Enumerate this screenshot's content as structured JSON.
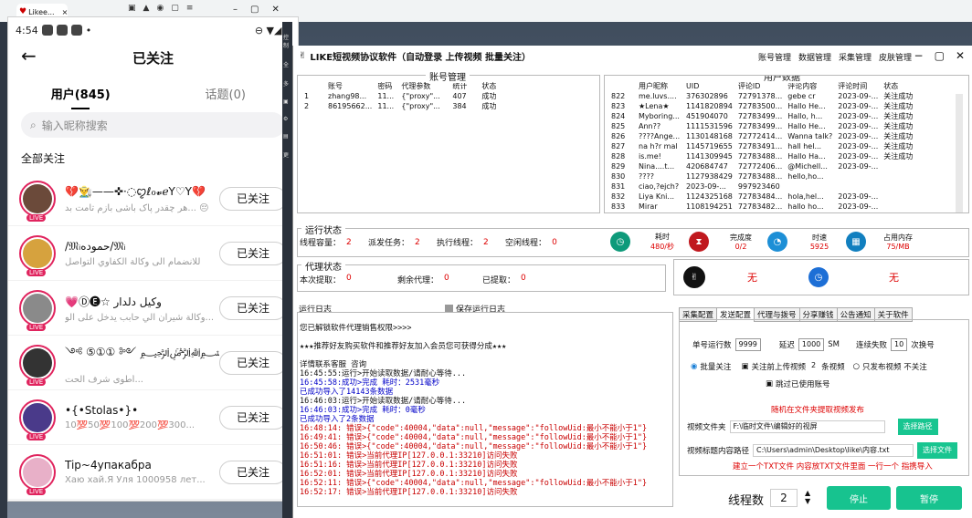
{
  "browser": {
    "tab_label": "Likee..."
  },
  "phone": {
    "time": "4:54",
    "title": "已关注",
    "tabs": [
      {
        "label": "用户(845)"
      },
      {
        "label": "话题(0)"
      }
    ],
    "search_placeholder": "输入昵称搜索",
    "section": "全部关注",
    "follow_label": "已关注",
    "live_label": "LIVE",
    "users": [
      {
        "name": "💔👨‍🌾——✜·◌ꨄℓℴ𝓿ℯY♡Y💔",
        "desc": "هر چقدر پاک باشی بازم تامت بد... 😔",
        "color": "#6b4a3a"
      },
      {
        "name": "/𝔐ᵢحموده/𝔐ᵢ",
        "desc": "للانضمام الى وكالة الكفاوي التواصل",
        "color": "#d6a23e"
      },
      {
        "name": "💗Ⓓ🅔☆ وكيل دلدار",
        "desc": "وكالة شيران الي حابب يدخل على الو...",
        "color": "#8a8a8a"
      },
      {
        "name": "༺ ⑤①① ༻ ﷽ سكدان ...د",
        "desc": "أطوى شرف الحت...",
        "color": "#333333"
      },
      {
        "name": "•{•Stolas•}•",
        "desc": "10💯50💯100💯200💯300...",
        "color": "#4a3a8a"
      },
      {
        "name": "Tip~4упакабра",
        "desc": "Хаю хай.Я Уля 1000958 лет...",
        "color": "#e8b0c8"
      }
    ]
  },
  "app": {
    "title": "LIKE短视频协议软件（自动登录 上传视频 批量关注）",
    "menu": [
      "账号管理",
      "数据管理",
      "采集管理",
      "皮肤管理"
    ],
    "accounts": {
      "caption": "账号管理",
      "headers": [
        "",
        "账号",
        "密码",
        "代理参数",
        "统计",
        "状态"
      ],
      "rows": [
        [
          "1",
          "zhang98...",
          "11...",
          "{\"proxy\"...",
          "407",
          "成功"
        ],
        [
          "2",
          "86195662...",
          "11...",
          "{\"proxy\"...",
          "384",
          "成功"
        ]
      ]
    },
    "users": {
      "caption": "用户数据",
      "headers": [
        "",
        "用户昵称",
        "UID",
        "评论ID",
        "评论内容",
        "评论时间",
        "状态"
      ],
      "rows": [
        [
          "822",
          "me.luvs....",
          "376302896",
          "72791378...",
          "gebe cr",
          "2023-09-...",
          "关注成功"
        ],
        [
          "823",
          "★Lena★",
          "1141820894",
          "72783500...",
          "Hallo He...",
          "2023-09-...",
          "关注成功"
        ],
        [
          "824",
          "Myboring...",
          "451904070",
          "72783499...",
          "Hallo, h...",
          "2023-09-...",
          "关注成功"
        ],
        [
          "825",
          "Ann??",
          "1111531596",
          "72783499...",
          "Hallo He...",
          "2023-09-...",
          "关注成功"
        ],
        [
          "826",
          "????Ange...",
          "1130148168",
          "72772414...",
          "Wanna talk?",
          "2023-09-...",
          "关注成功"
        ],
        [
          "827",
          "na h?r mal",
          "1145719655",
          "72783491...",
          "hall hel...",
          "2023-09-...",
          "关注成功"
        ],
        [
          "828",
          "is.me!",
          "1141309945",
          "72783488...",
          "Hallo Ha...",
          "2023-09-...",
          "关注成功"
        ],
        [
          "829",
          "Nina....t...",
          "420684747",
          "72772406...",
          "@Michell...",
          "2023-09-...",
          ""
        ],
        [
          "830",
          "????",
          "1127938429",
          "72783488...",
          "hello,ho...",
          "",
          ""
        ],
        [
          "831",
          "ciao,?ejch?",
          "2023-09-...",
          "997923460",
          "",
          "",
          ""
        ],
        [
          "832",
          "Liya Kni...",
          "1124325168",
          "72783484...",
          "hola,hel...",
          "2023-09-...",
          ""
        ],
        [
          "833",
          "Mirar",
          "1108194251",
          "72783482...",
          "hallo ho...",
          "2023-09-...",
          ""
        ]
      ]
    },
    "run": {
      "caption": "运行状态",
      "threads_label": "线程容量：",
      "threads": "2",
      "tasks_label": "派发任务：",
      "tasks": "2",
      "exec_label": "执行线程：",
      "exec": "2",
      "idle_label": "空闲线程：",
      "idle": "0",
      "time_label": "耗时",
      "time": "480/秒",
      "done_label": "完成度",
      "done": "0/2",
      "speed_label": "时速",
      "speed": "5925",
      "mem_label": "占用内存",
      "mem": "75/MB"
    },
    "proxy": {
      "caption": "代理状态",
      "extract_label": "本次提取：",
      "extract": "0",
      "remain_label": "剩余代理：",
      "remain": "0",
      "got_label": "已提取：",
      "got": "0",
      "status1": "无",
      "status2": "无"
    },
    "log": {
      "caption": "运行日志",
      "save_label": "保存运行日志",
      "lines": [
        {
          "t": "",
          "c": ""
        },
        {
          "t": "     您已解锁软件代理销售权限>>>>",
          "c": ""
        },
        {
          "t": "",
          "c": ""
        },
        {
          "t": "★★★推荐好友购买软件和推荐好友加入会员您可获得分成★★★",
          "c": ""
        },
        {
          "t": "",
          "c": ""
        },
        {
          "t": "详情联系客服  咨询",
          "c": ""
        },
        {
          "t": "16:45:55:运行>开始读取数据/请耐心等待...",
          "c": ""
        },
        {
          "t": "16:45:58:成功>完成 耗时：2531毫秒",
          "c": "b"
        },
        {
          "t": "已成功导入了14143条数据",
          "c": "b"
        },
        {
          "t": "16:46:03:运行>开始读取数据/请耐心等待...",
          "c": ""
        },
        {
          "t": "16:46:03:成功>完成 耗时：0毫秒",
          "c": "b"
        },
        {
          "t": "已成功导入了2条数据",
          "c": "b"
        },
        {
          "t": "16:48:14: 错误>{\"code\":40004,\"data\":null,\"message\":\"followUid:最小不能小于1\"}",
          "c": "r"
        },
        {
          "t": "16:49:41: 错误>{\"code\":40004,\"data\":null,\"message\":\"followUid:最小不能小于1\"}",
          "c": "r"
        },
        {
          "t": "16:50:46: 错误>{\"code\":40004,\"data\":null,\"message\":\"followUid:最小不能小于1\"}",
          "c": "r"
        },
        {
          "t": "16:51:01: 错误>当前代理IP[127.0.0.1:33210]访问失败",
          "c": "r"
        },
        {
          "t": "16:51:16: 错误>当前代理IP[127.0.0.1:33210]访问失败",
          "c": "r"
        },
        {
          "t": "16:52:01: 错误>当前代理IP[127.0.0.1:33210]访问失败",
          "c": "r"
        },
        {
          "t": "16:52:11: 错误>{\"code\":40004,\"data\":null,\"message\":\"followUid:最小不能小于1\"}",
          "c": "r"
        },
        {
          "t": "16:52:17: 错误>当前代理IP[127.0.0.1:33210]访问失败",
          "c": "r"
        }
      ]
    },
    "cfg": {
      "tabs": [
        "采集配置",
        "发送配置",
        "代理与拨号",
        "分享赚钱",
        "公告通知",
        "关于软件"
      ],
      "run_count_label": "单号运行数",
      "run_count": "9999",
      "delay_label": "延迟",
      "delay": "1000",
      "delay_unit": "SM",
      "fail_label": "连续失败",
      "fail": "10",
      "fail_unit": "次换号",
      "opt_batch": "批量关注",
      "opt_upload": "关注前上传视频",
      "upload_n": "2",
      "upload_unit": "条视频",
      "opt_only": "只发布视频 不关注",
      "opt_skip": "跳过已使用账号",
      "random_note": "随机在文件夹提取视频发布",
      "folder_label": "视频文件夹",
      "folder": "F:\\临时文件\\编辑好的视屏",
      "folder_btn": "选择路径",
      "path_label": "视频标题内容路径",
      "path": "C:\\Users\\admin\\Desktop\\like\\内容.txt",
      "path_btn": "选择文件",
      "tip": "建立一个TXT文件 内容放TXT文件里面 一行一个 指携导入"
    },
    "bottom": {
      "threads_label": "线程数",
      "threads": "2",
      "stop": "停止",
      "pause": "暂停"
    }
  }
}
